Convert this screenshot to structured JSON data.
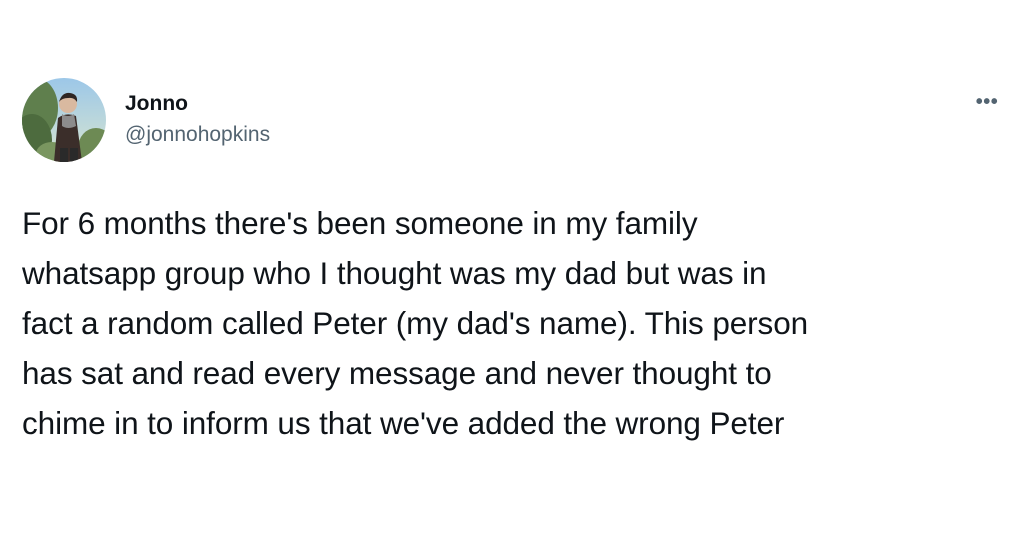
{
  "author": {
    "name": "Jonno",
    "handle": "@jonnohopkins",
    "avatar_icon": "profile-photo-avatar"
  },
  "more_icon": "more-options-icon",
  "more_label": "•••",
  "tweet": {
    "lines": [
      "For 6 months there's been someone in my family",
      "whatsapp group who I thought was my dad but was in",
      "fact a random called Peter (my dad's name). This person",
      "has sat and read every message and never thought to",
      "chime in to inform us that we've added the wrong Peter"
    ]
  },
  "colors": {
    "background": "#ffffff",
    "text": "#0f1419",
    "secondary_text": "#536471"
  }
}
